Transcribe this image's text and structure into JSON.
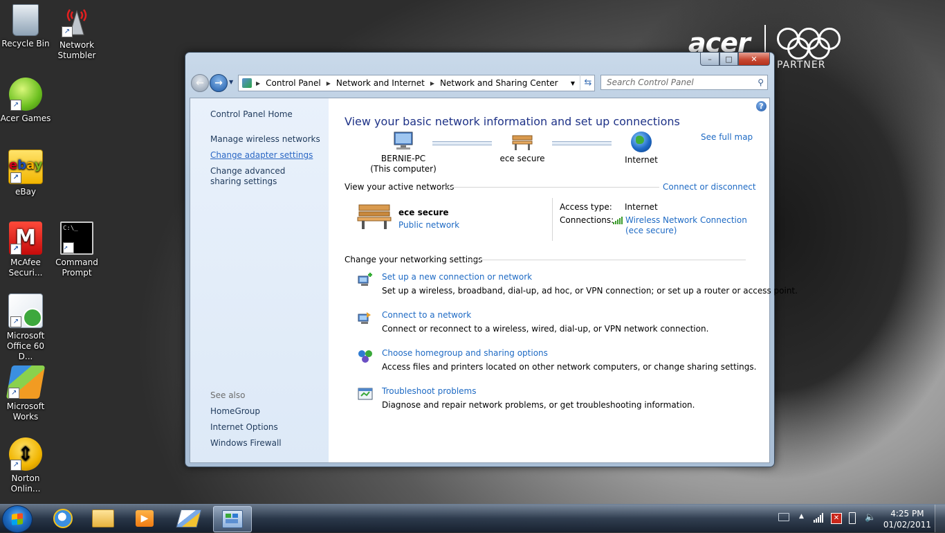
{
  "desktop": {
    "icons": [
      {
        "label": "Recycle Bin",
        "name": "recycle-bin-icon"
      },
      {
        "label": "Network Stumbler",
        "name": "network-stumbler-icon"
      },
      {
        "label": "Acer Games",
        "name": "acer-games-icon"
      },
      {
        "label": "eBay",
        "name": "ebay-icon"
      },
      {
        "label": "McAfee Securi...",
        "name": "mcafee-icon"
      },
      {
        "label": "Command Prompt",
        "name": "command-prompt-icon"
      },
      {
        "label": "Microsoft Office 60 D...",
        "name": "office-icon"
      },
      {
        "label": "Microsoft Works",
        "name": "works-icon"
      },
      {
        "label": "Norton Onlin...",
        "name": "norton-icon"
      }
    ],
    "brand": {
      "logo": "acer",
      "partner": "PARTNER"
    }
  },
  "window": {
    "controls": {
      "minimize": "–",
      "maximize": "□",
      "close": "✕"
    },
    "address": {
      "crumbs": [
        "Control Panel",
        "Network and Internet",
        "Network and Sharing Center"
      ]
    },
    "search_placeholder": "Search Control Panel",
    "left_pane": {
      "home": "Control Panel Home",
      "links": [
        "Manage wireless networks",
        "Change adapter settings",
        "Change advanced sharing settings"
      ],
      "see_also_label": "See also",
      "see_also": [
        "HomeGroup",
        "Internet Options",
        "Windows Firewall"
      ]
    },
    "main": {
      "title": "View your basic network information and set up connections",
      "see_full_map": "See full map",
      "map_nodes": [
        {
          "line1": "BERNIE-PC",
          "line2": "(This computer)"
        },
        {
          "line1": "ece secure",
          "line2": ""
        },
        {
          "line1": "Internet",
          "line2": ""
        }
      ],
      "active_networks_title": "View your active networks",
      "connect_disconnect": "Connect or disconnect",
      "network": {
        "name": "ece secure",
        "type": "Public network",
        "access_type_label": "Access type:",
        "access_type_value": "Internet",
        "connections_label": "Connections:",
        "connection_value_1": "Wireless Network Connection",
        "connection_value_2": "(ece secure)"
      },
      "change_settings_title": "Change your networking settings",
      "tasks": [
        {
          "title": "Set up a new connection or network",
          "desc": "Set up a wireless, broadband, dial-up, ad hoc, or VPN connection; or set up a router or access point."
        },
        {
          "title": "Connect to a network",
          "desc": "Connect or reconnect to a wireless, wired, dial-up, or VPN network connection."
        },
        {
          "title": "Choose homegroup and sharing options",
          "desc": "Access files and printers located on other network computers, or change sharing settings."
        },
        {
          "title": "Troubleshoot problems",
          "desc": "Diagnose and repair network problems, or get troubleshooting information."
        }
      ]
    }
  },
  "taskbar": {
    "clock_time": "4:25 PM",
    "clock_date": "01/02/2011"
  }
}
